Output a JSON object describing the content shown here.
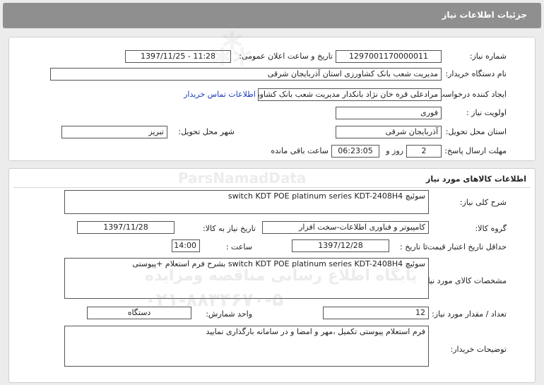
{
  "page": {
    "title": "جزئیات اطلاعات نیاز"
  },
  "need_info": {
    "need_number_label": "شماره نیاز:",
    "need_number": "1297001170000011",
    "announce_label": "تاریخ و ساعت اعلان عمومی:",
    "announce_value": "1397/11/25 - 11:28",
    "buyer_label": "نام دستگاه خریدار:",
    "buyer_value": "مدیریت شعب بانک کشاورزی استان آذربایجان شرقی",
    "requester_label": "ایجاد کننده درخواست:",
    "requester_value": "مرادعلی قره خان نژاد بانکدار مدیریت شعب بانک کشاورزی استان آذربایجان شرقی",
    "contact_link": "اطلاعات تماس خریدار",
    "priority_label": "اولویت نیاز :",
    "priority_value": "فوری",
    "province_label": "استان محل تحویل:",
    "province_value": "آذربایجان شرقی",
    "city_label": "شهر محل تحویل:",
    "city_value": "تبریز",
    "deadline_label": "مهلت ارسال پاسخ:",
    "days_value": "2",
    "days_label": "روز و",
    "time_value": "06:23:05",
    "time_label": "ساعت باقی مانده"
  },
  "goods": {
    "section_title": "اطلاعات کالاهای مورد نیاز",
    "summary_label": "شرح کلی نیاز:",
    "summary_value": "سوئیچ switch KDT  POE platinum series KDT-2408H4",
    "group_label": "گروه کالا:",
    "group_value": "کامپیوتر و فناوری اطلاعات-سخت افزار",
    "need_date_label": "تاریخ نیاز به کالا:",
    "need_date_value": "1397/11/28",
    "min_price_label": "حداقل تاریخ اعتبار قیمت:",
    "until_label": "تا تاریخ :",
    "price_date_value": "1397/12/28",
    "hour_label": "ساعت :",
    "hour_value": "14:00",
    "spec_label": "مشخصات کالای مورد نیاز:",
    "spec_value": "سوئیچ switch KDT  POE platinum series KDT-2408H4 بشرح فرم استعلام +پیوستی",
    "qty_label": "تعداد / مقدار مورد نیاز:",
    "qty_value": "12",
    "unit_label": "واحد شمارش:",
    "unit_value": "دستگاه",
    "buyer_notes_label": "توضیحات خریدار:",
    "buyer_notes_value": "فرم استعلام پیوستی تکمیل ،مهر و امضا و در سامانه بارگذاری نمایید"
  },
  "watermark": {
    "brand": "ParsNamadData",
    "line1": "پایگاه اطلاع رسانی مناقصه ومزایده",
    "phone": "۰۲۱-۸۸۳۴۶۷۰-۵"
  }
}
